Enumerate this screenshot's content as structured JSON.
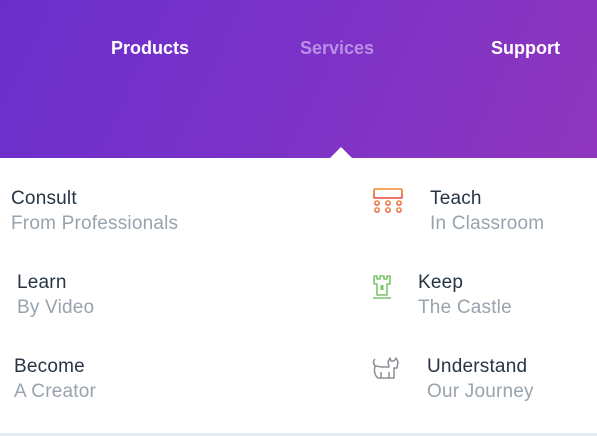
{
  "nav": {
    "products": "Products",
    "services": "Services",
    "support": "Support"
  },
  "menu": {
    "consult": {
      "title": "Consult",
      "subtitle": "From Professionals"
    },
    "learn": {
      "title": "Learn",
      "subtitle": "By Video"
    },
    "become": {
      "title": "Become",
      "subtitle": "A Creator"
    },
    "teach": {
      "title": "Teach",
      "subtitle": "In Classroom",
      "icon": "classroom-icon"
    },
    "keep": {
      "title": "Keep",
      "subtitle": "The Castle",
      "icon": "castle-icon"
    },
    "understand": {
      "title": "Understand",
      "subtitle": "Our Journey",
      "icon": "cat-icon"
    }
  },
  "colors": {
    "gradient_start": "#6a2fcb",
    "gradient_end": "#8f36be",
    "active_nav": "#b98fe8",
    "title_text": "#273444",
    "subtitle_text": "#98a3ae",
    "teach_icon": "#e8463a",
    "keep_icon": "#7cc46a",
    "understand_icon": "#8a8f96"
  }
}
